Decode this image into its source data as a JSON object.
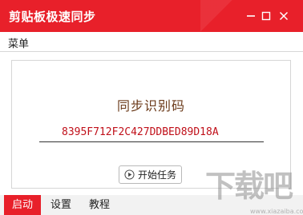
{
  "window": {
    "title": "剪贴板极速同步",
    "controls": {
      "minimize_icon": "minimize-icon",
      "maximize_icon": "maximize-icon",
      "close_icon": "close-icon"
    }
  },
  "menu": {
    "items": [
      {
        "label": "菜单"
      }
    ]
  },
  "main": {
    "code_label": "同步识别码",
    "code_value": "8395F712F2C427DDBED89D18A",
    "start_button": {
      "icon": "play-circle-icon",
      "label": "开始任务"
    }
  },
  "tabs": [
    {
      "label": "启动",
      "active": true
    },
    {
      "label": "设置",
      "active": false
    },
    {
      "label": "教程",
      "active": false
    }
  ],
  "watermark": {
    "main": "下载吧",
    "sub": "www.xiazaiba.com"
  },
  "colors": {
    "accent": "#e8202a",
    "code_text": "#c0101a",
    "label_text": "#6b3a1a"
  }
}
